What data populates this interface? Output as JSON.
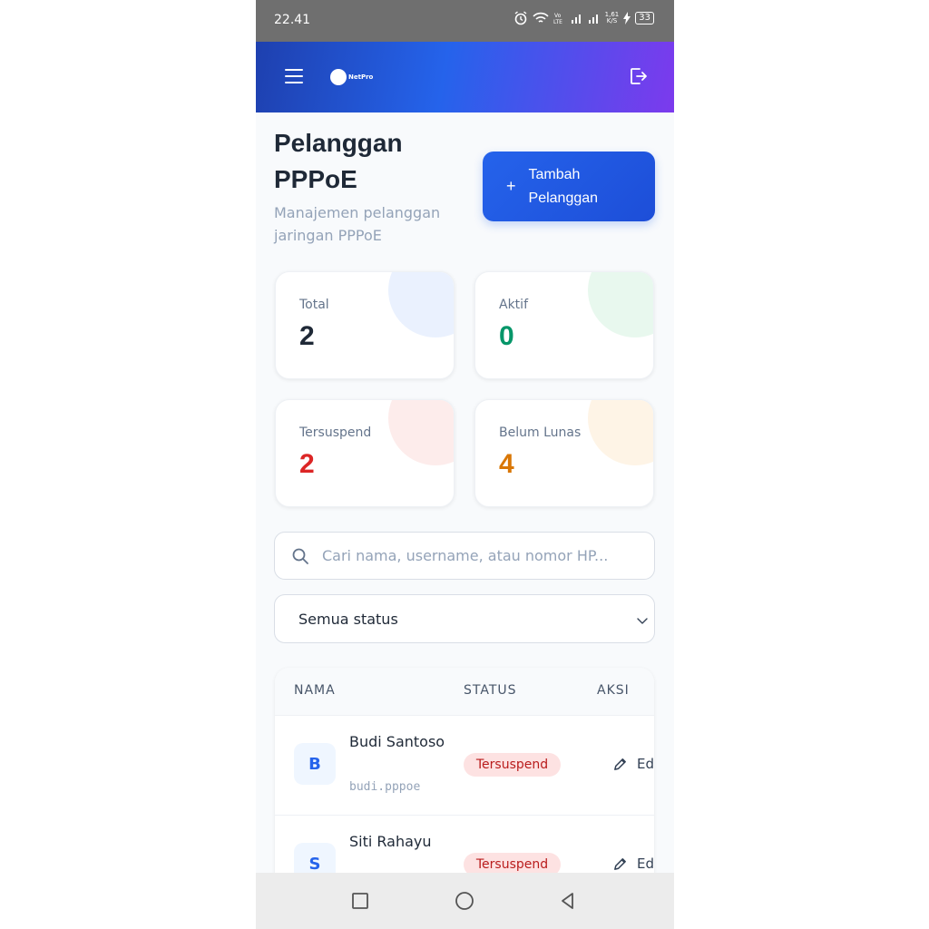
{
  "status_bar": {
    "time": "22.41",
    "net_speed": "1,61",
    "net_unit": "K/S",
    "battery": "33"
  },
  "header": {
    "logo_text": "NetPro"
  },
  "page": {
    "title": "Pelanggan PPPoE",
    "subtitle": "Manajemen pelanggan jaringan PPPoE",
    "add_label": "Tambah Pelanggan"
  },
  "stats": [
    {
      "label": "Total",
      "value": "2",
      "color": "#1f2937",
      "blob": "#eaf1fe"
    },
    {
      "label": "Aktif",
      "value": "0",
      "color": "#059669",
      "blob": "#e8f8ee"
    },
    {
      "label": "Tersuspend",
      "value": "2",
      "color": "#dc2626",
      "blob": "#fdeceb"
    },
    {
      "label": "Belum Lunas",
      "value": "4",
      "color": "#d97706",
      "blob": "#fef4e6"
    }
  ],
  "search": {
    "placeholder": "Cari nama, username, atau nomor HP..."
  },
  "filter": {
    "selected": "Semua status"
  },
  "table": {
    "columns": [
      "NAMA",
      "STATUS",
      "AKSI"
    ],
    "rows": [
      {
        "initial": "B",
        "name": "Budi Santoso",
        "username": "budi.pppoe",
        "status": "Tersuspend",
        "action": "Ed"
      },
      {
        "initial": "S",
        "name": "Siti Rahayu",
        "username": "",
        "status": "Tersuspend",
        "action": "Ed"
      }
    ]
  }
}
